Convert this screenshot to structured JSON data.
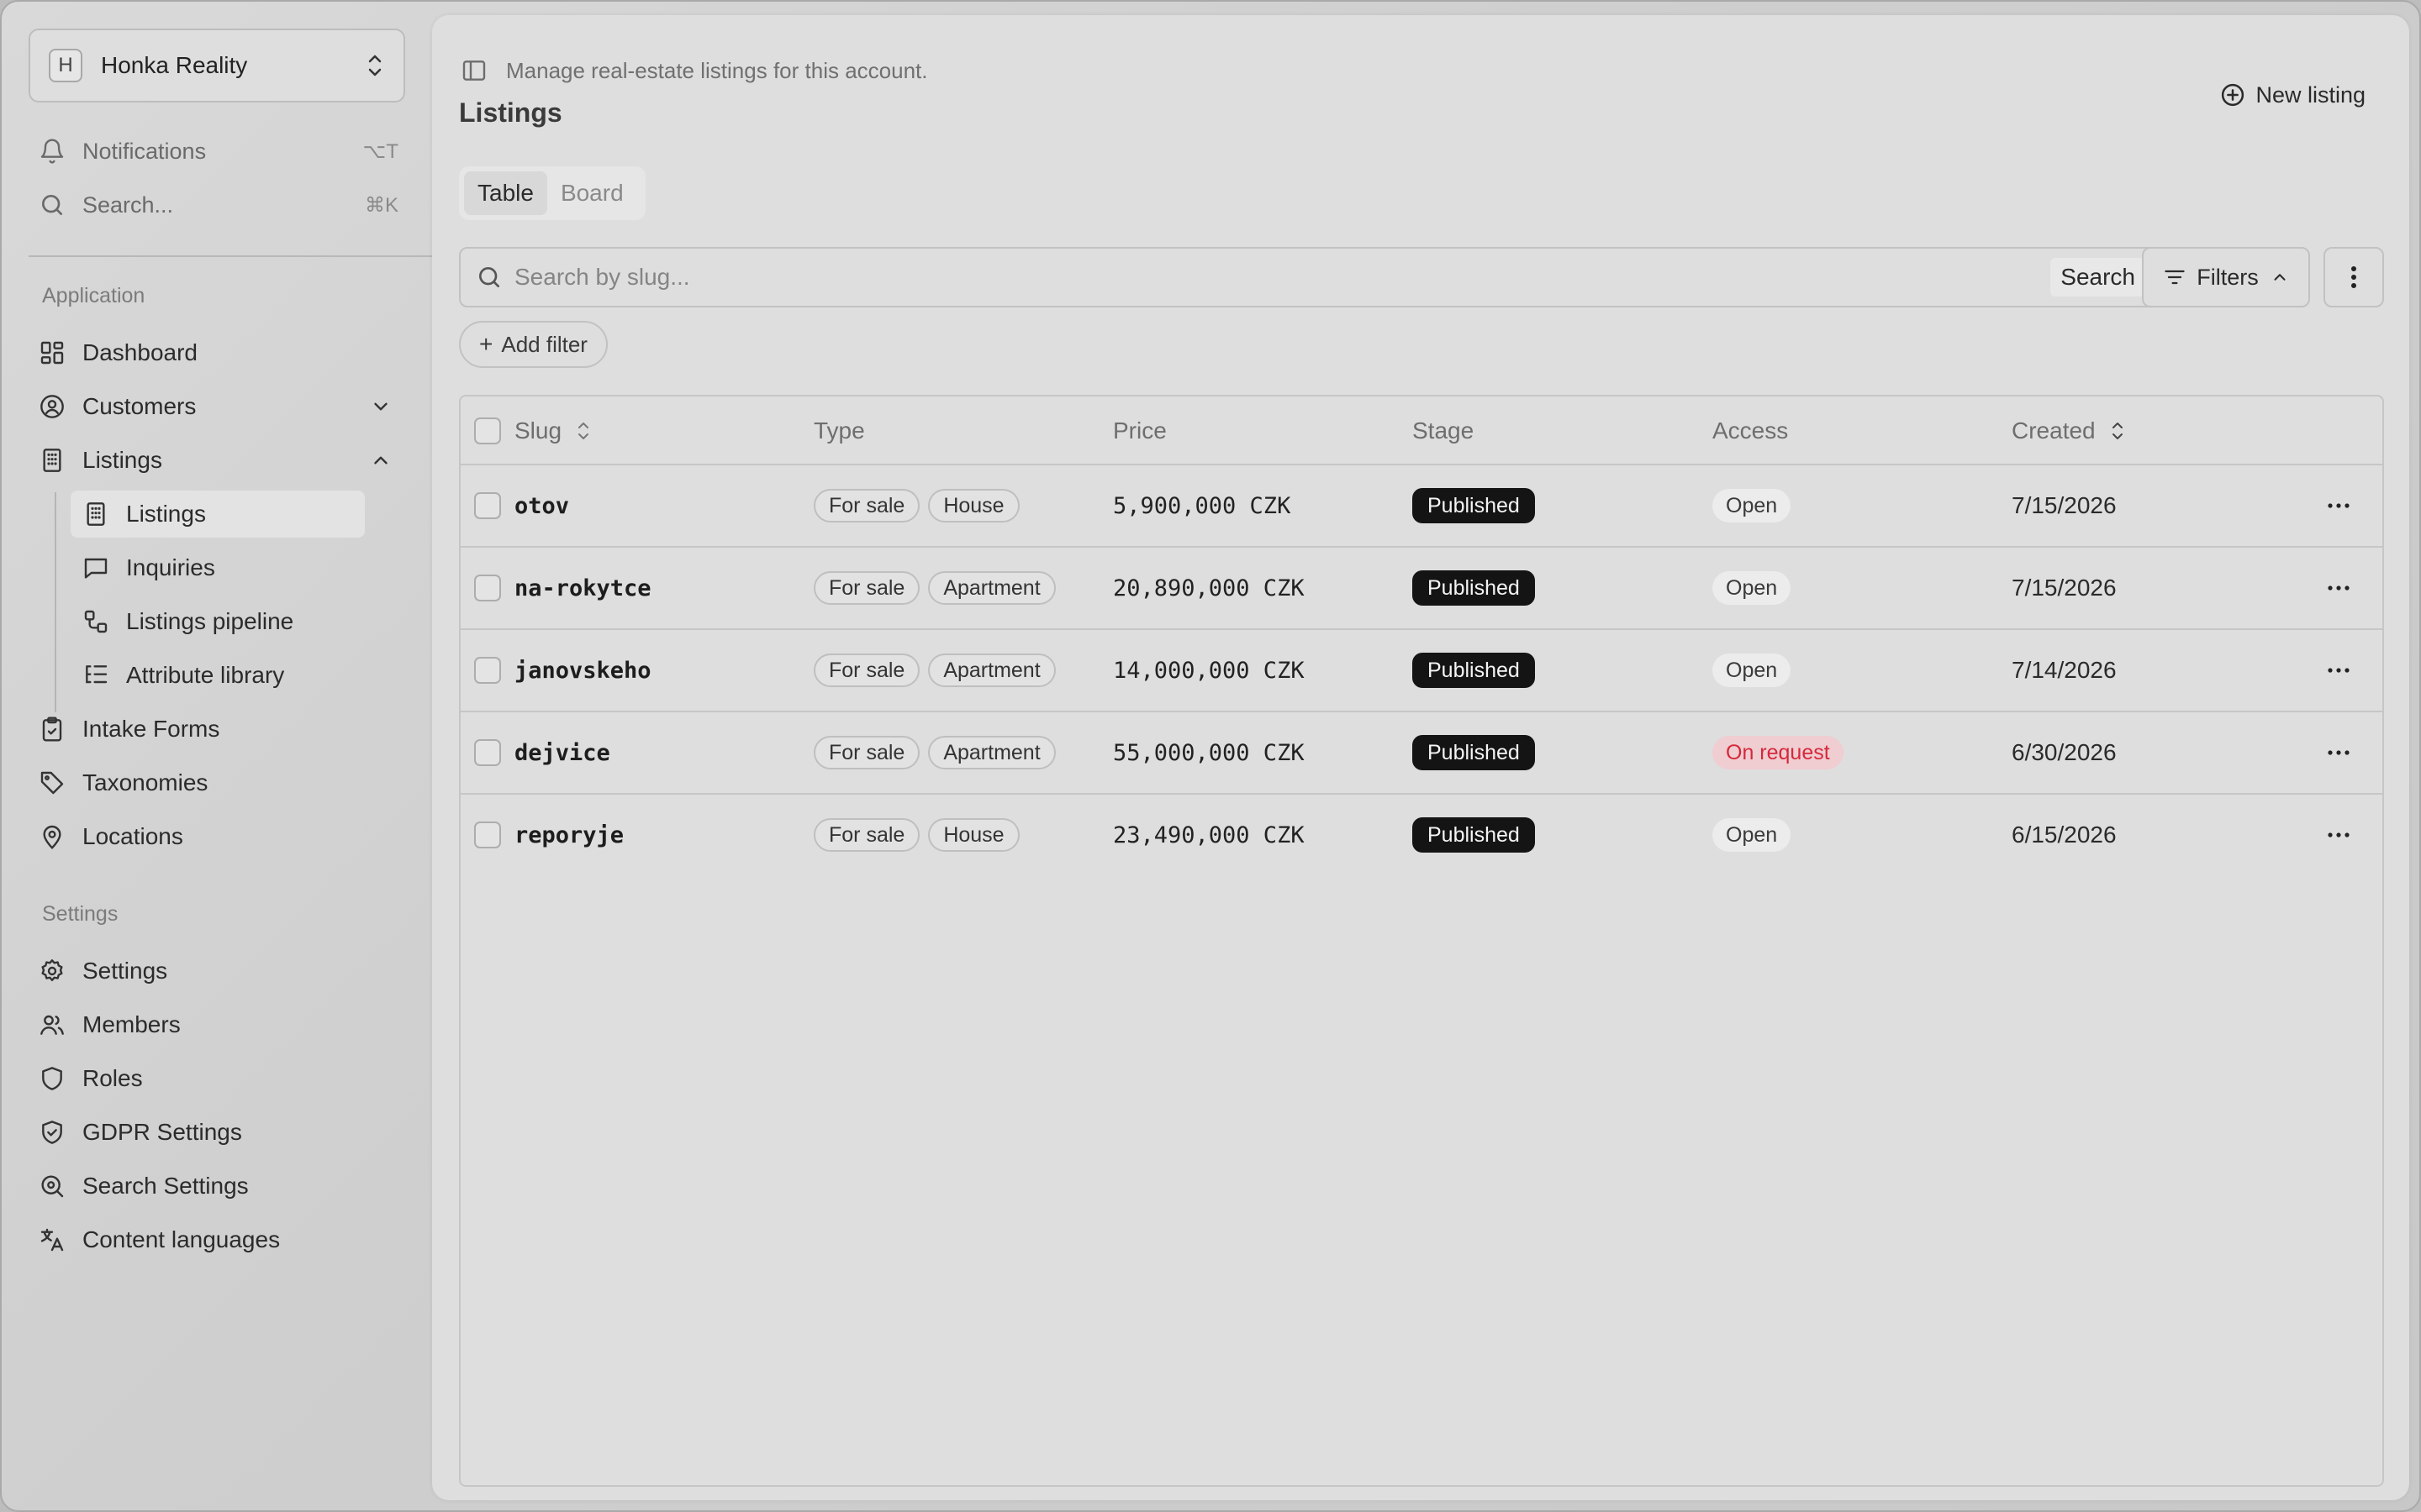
{
  "sidebar": {
    "account": {
      "avatar_letter": "H",
      "name": "Honka Reality"
    },
    "quick": [
      {
        "label": "Notifications",
        "shortcut": "⌥T",
        "icon": "bell-icon"
      },
      {
        "label": "Search...",
        "shortcut": "⌘K",
        "icon": "search-icon"
      }
    ],
    "sections": [
      {
        "label": "Application"
      },
      {
        "label": "Settings"
      }
    ],
    "app_items": [
      {
        "label": "Dashboard",
        "icon": "dashboard-icon"
      },
      {
        "label": "Customers",
        "icon": "user-circle-icon"
      },
      {
        "label": "Listings",
        "icon": "building-icon"
      },
      {
        "label": "Intake Forms",
        "icon": "clipboard-icon"
      },
      {
        "label": "Taxonomies",
        "icon": "tag-icon"
      },
      {
        "label": "Locations",
        "icon": "map-pin-icon"
      }
    ],
    "listings_sub": [
      {
        "label": "Listings",
        "icon": "building-icon"
      },
      {
        "label": "Inquiries",
        "icon": "message-icon"
      },
      {
        "label": "Listings pipeline",
        "icon": "workflow-icon"
      },
      {
        "label": "Attribute library",
        "icon": "list-tree-icon"
      }
    ],
    "settings_items": [
      {
        "label": "Settings",
        "icon": "gear-icon"
      },
      {
        "label": "Members",
        "icon": "users-icon"
      },
      {
        "label": "Roles",
        "icon": "shield-icon"
      },
      {
        "label": "GDPR Settings",
        "icon": "shield-check-icon"
      },
      {
        "label": "Search Settings",
        "icon": "search-settings-icon"
      },
      {
        "label": "Content languages",
        "icon": "translate-icon"
      }
    ]
  },
  "header": {
    "subtitle": "Manage real-estate listings for this account.",
    "title": "Listings",
    "new_listing_label": "New listing"
  },
  "view_tabs": [
    {
      "label": "Table",
      "active": true
    },
    {
      "label": "Board",
      "active": false
    }
  ],
  "search": {
    "placeholder": "Search by slug...",
    "value": "",
    "button_label": "Search"
  },
  "filters_label": "Filters",
  "add_filter_label": "Add filter",
  "table": {
    "columns": [
      "Slug",
      "Type",
      "Price",
      "Stage",
      "Access",
      "Created"
    ],
    "rows": [
      {
        "slug": "otov",
        "types": [
          "For sale",
          "House"
        ],
        "price": "5,900,000 CZK",
        "stage": "Published",
        "access": "Open",
        "created": "7/15/2026"
      },
      {
        "slug": "na-rokytce",
        "types": [
          "For sale",
          "Apartment"
        ],
        "price": "20,890,000 CZK",
        "stage": "Published",
        "access": "Open",
        "created": "7/15/2026"
      },
      {
        "slug": "janovskeho",
        "types": [
          "For sale",
          "Apartment"
        ],
        "price": "14,000,000 CZK",
        "stage": "Published",
        "access": "Open",
        "created": "7/14/2026"
      },
      {
        "slug": "dejvice",
        "types": [
          "For sale",
          "Apartment"
        ],
        "price": "55,000,000 CZK",
        "stage": "Published",
        "access": "On request",
        "created": "6/30/2026"
      },
      {
        "slug": "reporyje",
        "types": [
          "For sale",
          "House"
        ],
        "price": "23,490,000 CZK",
        "stage": "Published",
        "access": "Open",
        "created": "6/15/2026"
      }
    ]
  },
  "colors": {
    "accent_dark": "#141414",
    "danger_text": "#d6283b",
    "danger_bg": "#efcdd1"
  }
}
